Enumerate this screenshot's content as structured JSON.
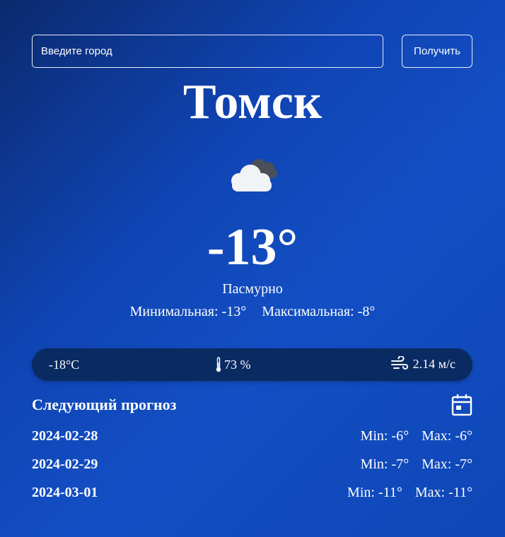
{
  "search": {
    "placeholder": "Введите город",
    "button_label": "Получить"
  },
  "current": {
    "city": "Томск",
    "icon": "cloudy-icon",
    "temperature": "-13°",
    "description": "Пасмурно",
    "min_label": "Минимальная: -13°",
    "max_label": "Максимальная: -8°"
  },
  "details": {
    "feels_like": "-18°C",
    "humidity": "73 %",
    "humidity_icon": "thermometer-icon",
    "wind": "2.14 м/с",
    "wind_icon": "wind-icon"
  },
  "forecast": {
    "title": "Следующий прогноз",
    "icon": "calendar-icon",
    "days": [
      {
        "date": "2024-02-28",
        "min": "Min: -6°",
        "max": "Max: -6°"
      },
      {
        "date": "2024-02-29",
        "min": "Min: -7°",
        "max": "Max: -7°"
      },
      {
        "date": "2024-03-01",
        "min": "Min: -11°",
        "max": "Max: -11°"
      }
    ]
  }
}
